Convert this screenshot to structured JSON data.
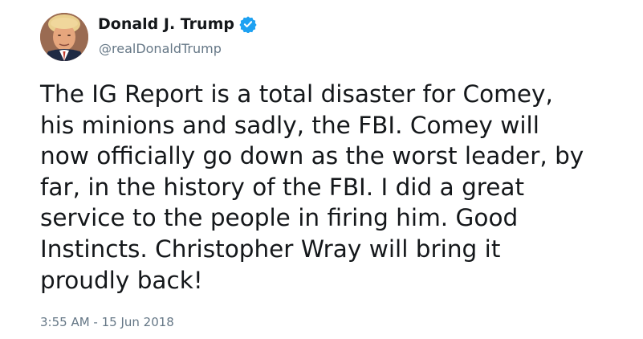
{
  "author": {
    "display_name": "Donald J. Trump",
    "handle": "@realDonaldTrump",
    "verified": true,
    "verified_icon": "verified-badge-icon",
    "verified_color": "#1da1f2"
  },
  "tweet": {
    "text": "The IG Report is a total disaster for Comey,\nhis minions and sadly, the FBI. Comey will\nnow officially go down as the worst leader, by\nfar, in the history of the FBI. I did a great\nservice to the people in firing him. Good\nInstincts. Christopher Wray will bring it\nproudly back!",
    "timestamp": "3:55 AM - 15 Jun 2018"
  },
  "colors": {
    "text": "#14171a",
    "secondary": "#657786",
    "background": "#ffffff"
  }
}
